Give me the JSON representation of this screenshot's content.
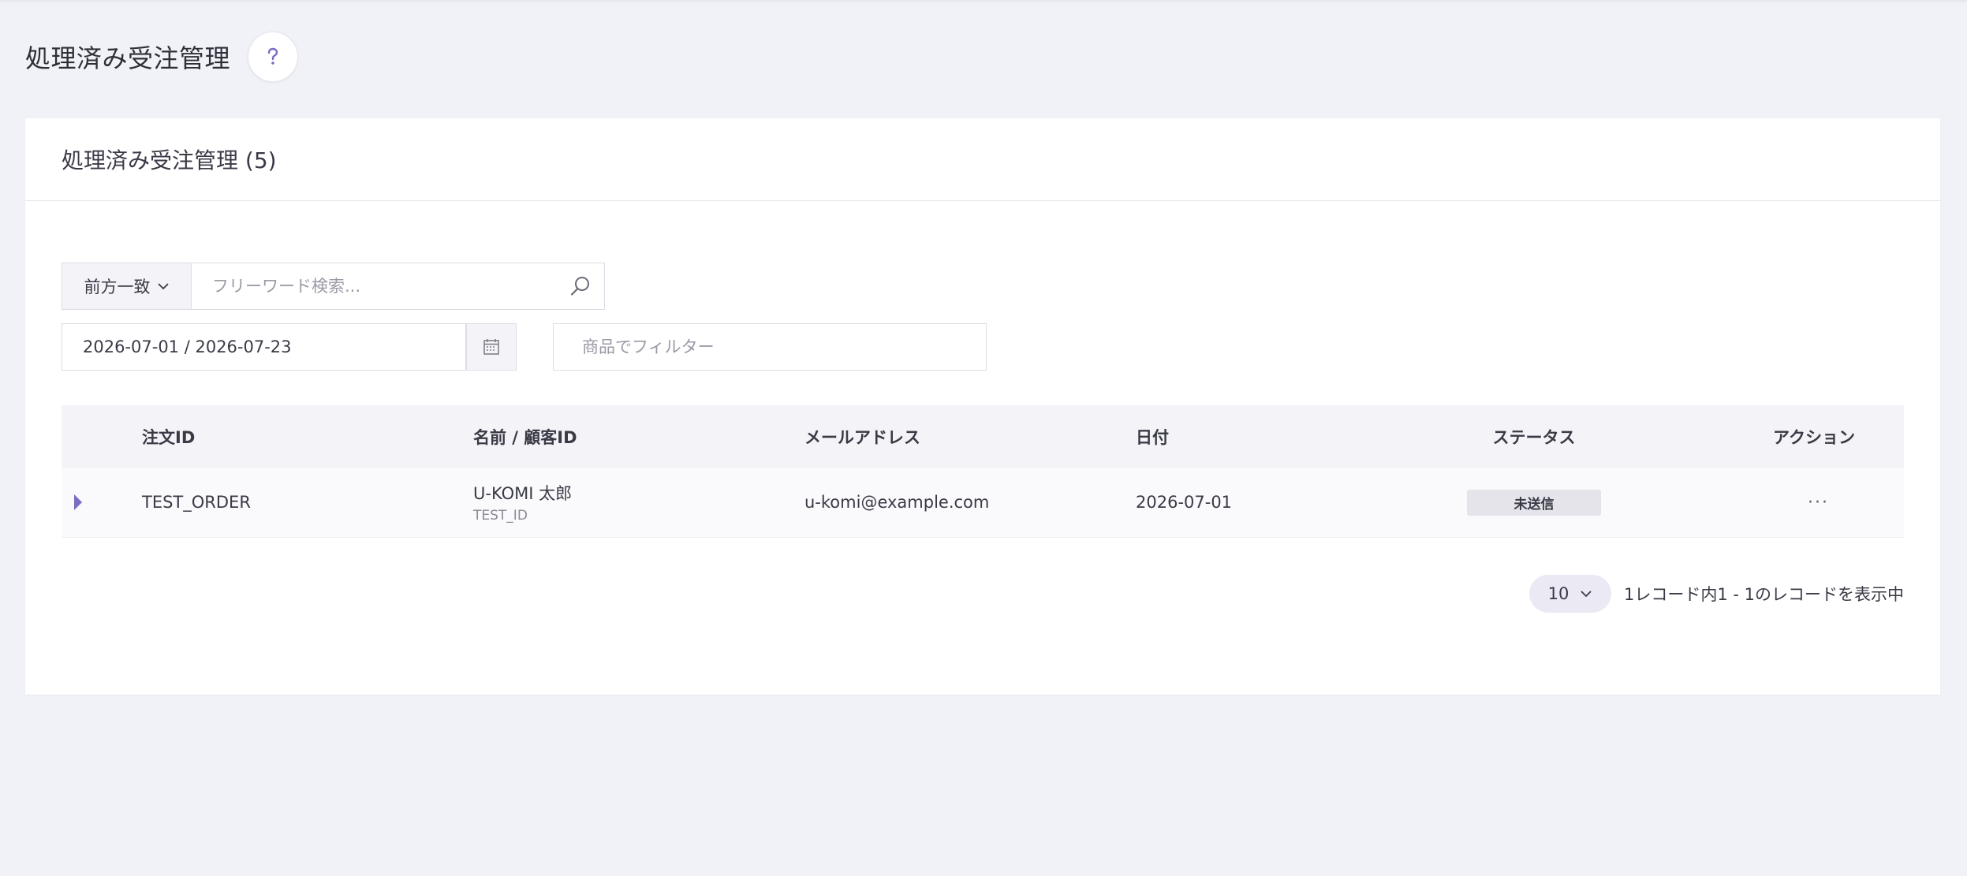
{
  "page": {
    "title": "処理済み受注管理",
    "help_icon": "question-mark-icon"
  },
  "card": {
    "title": "処理済み受注管理 (5)"
  },
  "search": {
    "match_mode": "前方一致",
    "placeholder": "フリーワード検索...",
    "value": ""
  },
  "filters": {
    "date_range": "2026-07-01 / 2026-07-23",
    "product_placeholder": "商品でフィルター",
    "product_value": ""
  },
  "table": {
    "columns": {
      "order_id": "注文ID",
      "name": "名前 / 顧客ID",
      "email": "メールアドレス",
      "date": "日付",
      "status": "ステータス",
      "action": "アクション"
    },
    "rows": [
      {
        "order_id": "TEST_ORDER",
        "name": "U-KOMI 太郎",
        "customer_id": "TEST_ID",
        "email": "u-komi@example.com",
        "date": "2026-07-01",
        "status": "未送信",
        "action": "···"
      }
    ]
  },
  "pagination": {
    "page_size": "10",
    "info": "1レコード内1 - 1のレコードを表示中"
  },
  "colors": {
    "accent": "#7b6cc4",
    "background": "#f1f2f7",
    "status_badge": "#e4e4ea"
  }
}
